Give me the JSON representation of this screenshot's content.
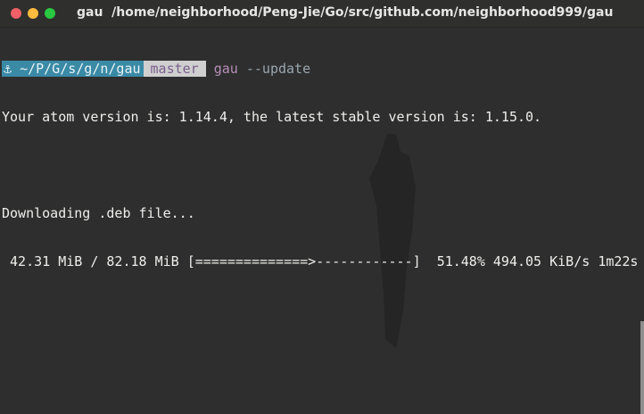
{
  "window": {
    "title": "gau  /home/neighborhood/Peng-Jie/Go/src/github.com/neighborhood999/gau"
  },
  "prompt": {
    "anchor_icon": "⚓",
    "directory": "~/P/G/s/g/n/gau",
    "branch": "master",
    "command": "gau",
    "argument": "--update"
  },
  "output": {
    "version_line": "Your atom version is: 1.14.4, the latest stable version is: 1.15.0.",
    "download_line": "Downloading .deb file...",
    "progress": {
      "downloaded": "42.31 MiB / 82.18 MiB",
      "bar": "[==============>------------]",
      "percent": "51.48%",
      "speed": "494.05 KiB/s",
      "eta": "1m22s",
      "fraction": 0.5148
    }
  },
  "colors": {
    "background": "#2e2e2e",
    "dir_segment": "#3a8aa6",
    "git_segment": "#cfcfcf",
    "command": "#b68fb8"
  }
}
